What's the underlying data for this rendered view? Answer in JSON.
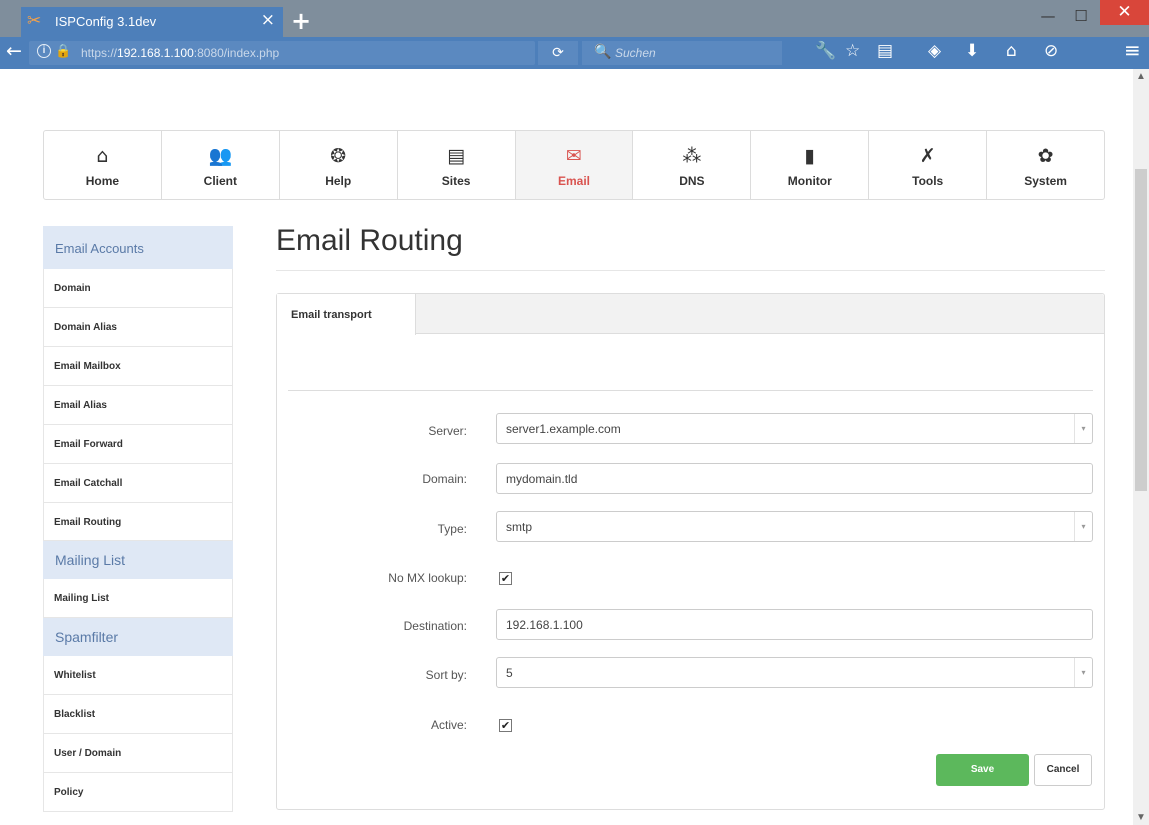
{
  "browser": {
    "tab_title": "ISPConfig 3.1dev",
    "tab_close": "×",
    "new_tab": "+",
    "url_prefix": "https://",
    "url_host": "192.168.1.100",
    "url_rest": ":8080/index.php",
    "search_placeholder": "Suchen",
    "icons": {
      "favicon": "✂",
      "back": "←",
      "lock": "🔒",
      "reload": "⟳",
      "search": "🔍",
      "wrench": "🔧",
      "star": "☆",
      "reader": "▤",
      "pocket": "◈",
      "download": "⬇",
      "home": "⌂",
      "addon": "⊘",
      "menu": "≡"
    },
    "window": {
      "minimize": "—",
      "maximize": "☐",
      "close": "✕"
    }
  },
  "modules": [
    {
      "label": "Home",
      "icon": "home-icon",
      "glyph": "⌂",
      "active": false
    },
    {
      "label": "Client",
      "icon": "users-icon",
      "glyph": "👥",
      "active": false
    },
    {
      "label": "Help",
      "icon": "lifebuoy-icon",
      "glyph": "❂",
      "active": false
    },
    {
      "label": "Sites",
      "icon": "browser-icon",
      "glyph": "▤",
      "active": false
    },
    {
      "label": "Email",
      "icon": "envelope-icon",
      "glyph": "✉",
      "active": true
    },
    {
      "label": "DNS",
      "icon": "network-icon",
      "glyph": "⁂",
      "active": false
    },
    {
      "label": "Monitor",
      "icon": "traffic-light-icon",
      "glyph": "▮",
      "active": false
    },
    {
      "label": "Tools",
      "icon": "tools-icon",
      "glyph": "✗",
      "active": false
    },
    {
      "label": "System",
      "icon": "gear-icon",
      "glyph": "✿",
      "active": false
    }
  ],
  "sidebar": {
    "sections": [
      {
        "title": "Email Accounts",
        "items": [
          "Domain",
          "Domain Alias",
          "Email Mailbox",
          "Email Alias",
          "Email Forward",
          "Email Catchall",
          "Email Routing"
        ]
      },
      {
        "title": "Mailing List",
        "items": [
          "Mailing List"
        ]
      },
      {
        "title": "Spamfilter",
        "items": [
          "Whitelist",
          "Blacklist",
          "User / Domain",
          "Policy"
        ]
      }
    ]
  },
  "main": {
    "title": "Email Routing",
    "tab": "Email transport",
    "form": {
      "server_label": "Server:",
      "server_value": "server1.example.com",
      "domain_label": "Domain:",
      "domain_value": "mydomain.tld",
      "type_label": "Type:",
      "type_value": "smtp",
      "nomx_label": "No MX lookup:",
      "nomx_checked": true,
      "destination_label": "Destination:",
      "destination_value": "192.168.1.100",
      "sortby_label": "Sort by:",
      "sortby_value": "5",
      "active_label": "Active:",
      "active_checked": true,
      "check_mark": "✔",
      "select_caret": "▾"
    },
    "save_label": "Save",
    "cancel_label": "Cancel"
  },
  "colors": {
    "accent": "#d9534f",
    "tab_blue": "#4d7fba",
    "save_green": "#5cb85c",
    "sidebar_header_bg": "#dfe8f5"
  }
}
